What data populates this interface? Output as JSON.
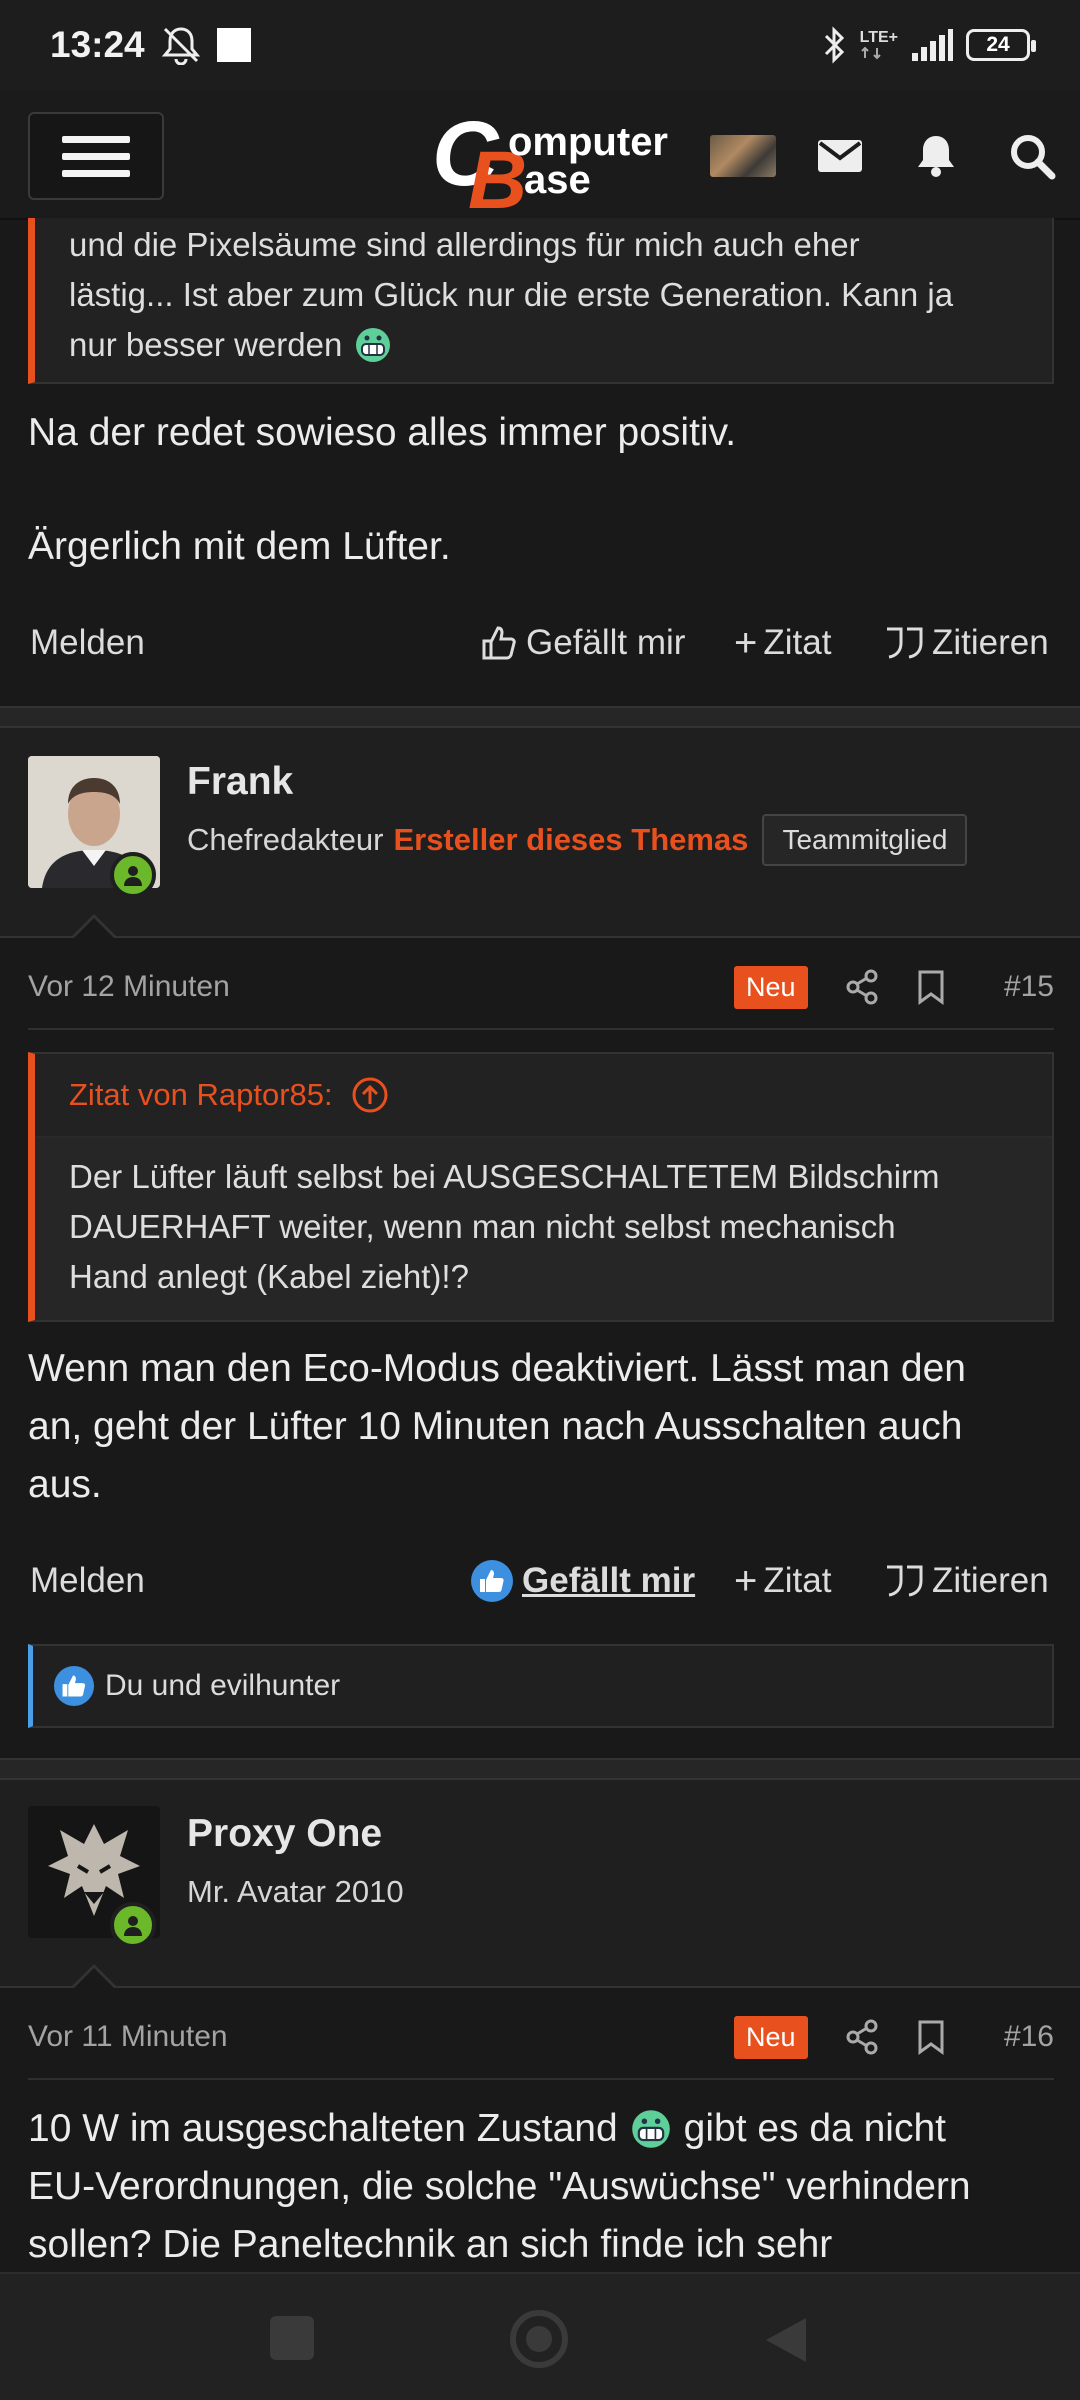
{
  "status_bar": {
    "time": "13:24",
    "network": "LTE+",
    "battery": "24"
  },
  "header": {
    "logo_top": "omputer",
    "logo_bottom": "ase",
    "logo_c": "C",
    "logo_b": "B"
  },
  "prev_post": {
    "quote_lines": [
      "und die Pixelsäume sind allerdings für mich auch eher",
      "lästig... Ist aber zum Glück nur die erste Generation. Kann ja",
      "nur besser werden"
    ],
    "text_line1": "Na der redet sowieso alles immer positiv.",
    "text_line2": "Ärgerlich mit dem Lüfter.",
    "actions": {
      "report": "Melden",
      "like": "Gefällt mir",
      "quote_plus": "Zitat",
      "quote": "Zitieren"
    }
  },
  "post15": {
    "username": "Frank",
    "role": "Chefredakteur",
    "creator_label": "Ersteller dieses Themas",
    "badge": "Teammitglied",
    "time": "Vor 12 Minuten",
    "new_badge": "Neu",
    "number": "#15",
    "quote_header": "Zitat von Raptor85:",
    "quote_lines": [
      "Der Lüfter läuft selbst bei AUSGESCHALTETEM Bildschirm",
      "DAUERHAFT weiter, wenn man nicht selbst mechanisch",
      "Hand anlegt (Kabel zieht)!?"
    ],
    "text_lines": [
      "Wenn man den Eco-Modus deaktiviert. Lässt man den",
      "an, geht der Lüfter 10 Minuten nach Ausschalten auch",
      "aus."
    ],
    "actions": {
      "report": "Melden",
      "like": "Gefällt mir",
      "quote_plus": "Zitat",
      "quote": "Zitieren"
    },
    "reactions": "Du und evilhunter"
  },
  "post16": {
    "username": "Proxy One",
    "user_title": "Mr. Avatar 2010",
    "time": "Vor 11 Minuten",
    "new_badge": "Neu",
    "number": "#16",
    "text_line1_a": "10 W im ausgeschalteten Zustand",
    "text_line1_b": "gibt es da nicht",
    "text_line2": "EU-Verordnungen, die solche \"Auswüchse\" verhindern",
    "text_line3": "sollen? Die Paneltechnik an sich finde ich sehr"
  },
  "colors": {
    "accent": "#e8501e",
    "online": "#6bb82a",
    "like_blue": "#3d8fe0"
  }
}
